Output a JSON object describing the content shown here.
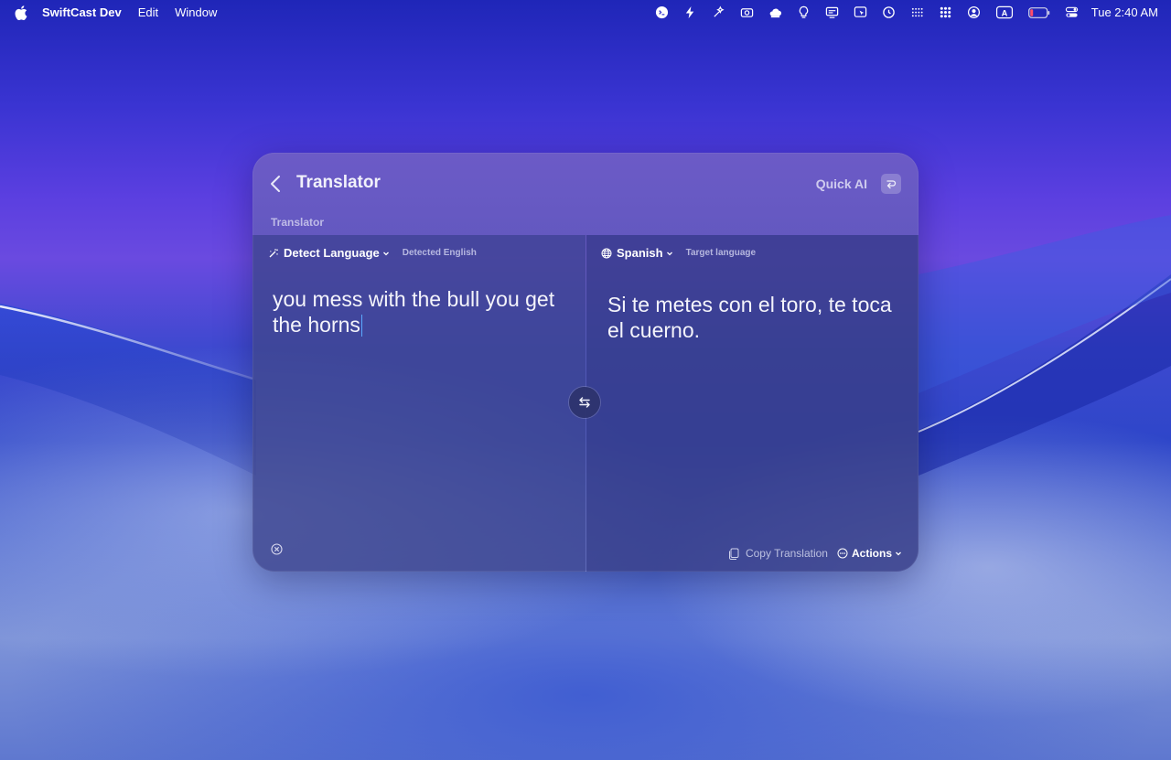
{
  "menubar": {
    "app_name": "SwiftCast Dev",
    "menus": [
      "Edit",
      "Window"
    ],
    "clock": "Tue 2:40 AM",
    "status_icons": [
      "terminal-icon",
      "bolt-icon",
      "sparkle-icon",
      "camera-icon",
      "cloud-icon",
      "bulb-icon",
      "display-icon",
      "cursor-icon",
      "refresh-icon",
      "grid-icon",
      "dots-icon",
      "user-icon",
      "keyboard-a-icon",
      "battery-icon",
      "control-center-icon"
    ],
    "keyboard_letter": "A"
  },
  "window": {
    "title": "Translator",
    "quick_ai_label": "Quick AI",
    "section_label": "Translator",
    "source": {
      "language": "Detect Language",
      "sub_label": "Detected English",
      "text": "you mess with the bull you get the horns"
    },
    "target": {
      "language": "Spanish",
      "sub_label": "Target language",
      "text": "Si te metes con el toro, te toca el cuerno."
    },
    "copy_label": "Copy Translation",
    "actions_label": "Actions"
  },
  "colors": {
    "caret": "#5aa9ff",
    "text": "#f4f4fb"
  }
}
